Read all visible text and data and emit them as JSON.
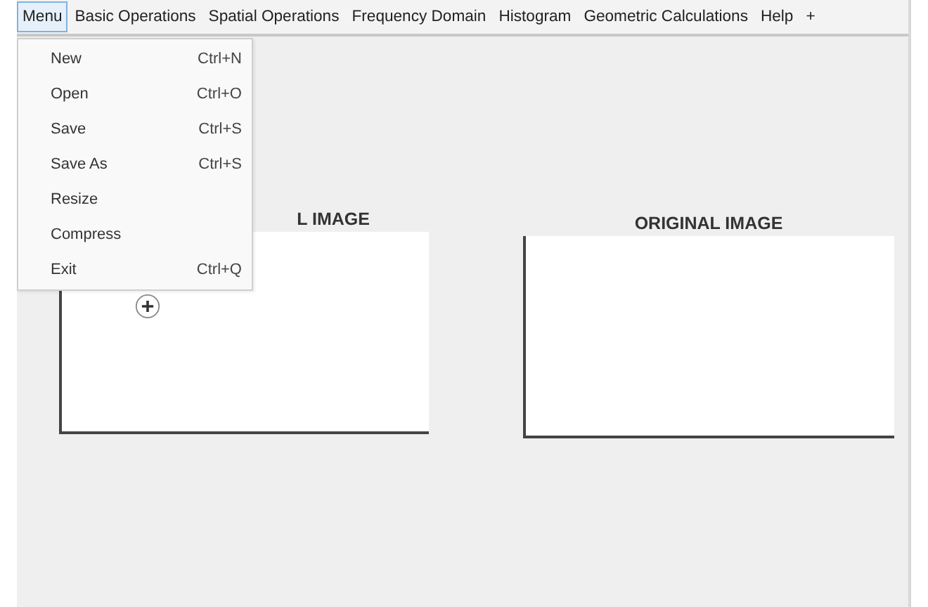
{
  "menubar": [
    {
      "label": "Menu",
      "selected": true
    },
    {
      "label": "Basic Operations",
      "selected": false
    },
    {
      "label": "Spatial Operations",
      "selected": false
    },
    {
      "label": "Frequency Domain",
      "selected": false
    },
    {
      "label": "Histogram",
      "selected": false
    },
    {
      "label": "Geometric Calculations",
      "selected": false
    },
    {
      "label": "Help",
      "selected": false
    },
    {
      "label": "+",
      "selected": false
    }
  ],
  "dropdown": {
    "items": [
      {
        "label": "New",
        "shortcut": "Ctrl+N"
      },
      {
        "label": "Open",
        "shortcut": "Ctrl+O"
      },
      {
        "label": "Save",
        "shortcut": "Ctrl+S"
      },
      {
        "label": "Save As",
        "shortcut": "Ctrl+S"
      },
      {
        "label": "Resize"
      },
      {
        "label": "Compress"
      },
      {
        "label": "Exit",
        "shortcut": "Ctrl+Q"
      }
    ]
  },
  "axes": [
    {
      "title": "L IMAGE"
    },
    {
      "title": "ORIGINAL IMAGE"
    }
  ]
}
